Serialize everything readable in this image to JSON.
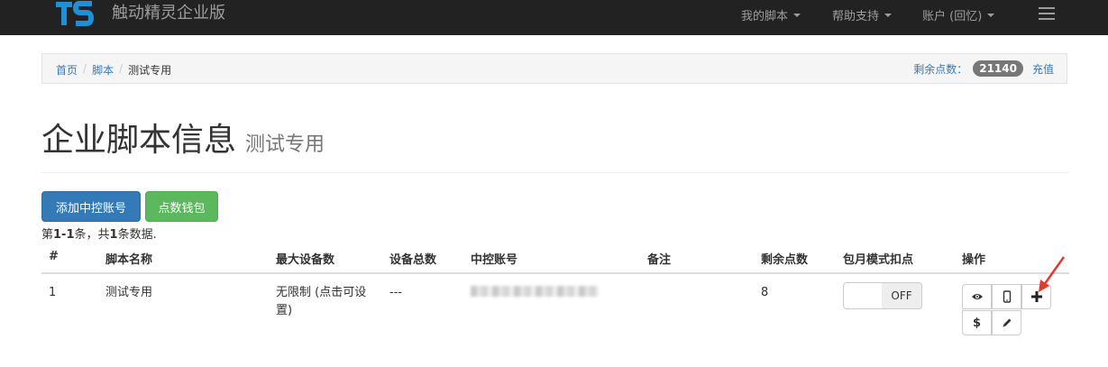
{
  "navbar": {
    "brand": "触动精灵企业版",
    "menu": [
      {
        "label": "我的脚本"
      },
      {
        "label": "帮助支持"
      },
      {
        "label": "账户 (回忆)"
      }
    ]
  },
  "breadcrumb": {
    "items": [
      "首页",
      "脚本"
    ],
    "active": "测试专用"
  },
  "points": {
    "label": "剩余点数：",
    "value": "21140",
    "recharge": "充值"
  },
  "page": {
    "title": "企业脚本信息",
    "subtitle": "测试专用"
  },
  "buttons": {
    "add_account": "添加中控账号",
    "wallet": "点数钱包"
  },
  "summary": {
    "prefix": "第",
    "range": "1-1",
    "mid": "条，共",
    "total": "1",
    "suffix": "条数据."
  },
  "table": {
    "headers": [
      "#",
      "脚本名称",
      "最大设备数",
      "设备总数",
      "中控账号",
      "备注",
      "剩余点数",
      "包月模式扣点",
      "操作"
    ],
    "rows": [
      {
        "index": "1",
        "name": "测试专用",
        "max_devices_1": "无限制 (点击可设",
        "max_devices_2": "置)",
        "device_total": "---",
        "remark": "",
        "points": "8",
        "monthly_toggle": "OFF"
      }
    ]
  },
  "actions": {
    "dollar": "$"
  },
  "colors": {
    "navbar": "#222222",
    "primary": "#337ab7",
    "success": "#5cb85c",
    "annotation_arrow": "#e8392f"
  }
}
